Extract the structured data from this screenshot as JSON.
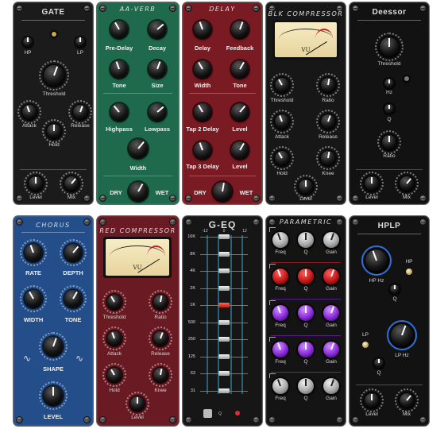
{
  "gate": {
    "title": "GATE",
    "hp": "HP",
    "lp": "LP",
    "threshold": "Threshold",
    "attack": "Attack",
    "release": "Release",
    "hold": "Hold",
    "level": "Level",
    "mix": "Mix"
  },
  "aaverb": {
    "title": "AA-VERB",
    "pre_delay": "Pre-Delay",
    "decay": "Decay",
    "tone": "Tone",
    "size": "Size",
    "highpass": "Highpass",
    "lowpass": "Lowpass",
    "width": "Width",
    "dry": "DRY",
    "wet": "WET"
  },
  "delay": {
    "title": "DELAY",
    "delay": "Delay",
    "feedback": "Feedback",
    "width": "Width",
    "tone": "Tone",
    "tap2_delay": "Tap 2 Delay",
    "level": "Level",
    "tap3_delay": "Tap 3 Delay",
    "level2": "Level",
    "dry": "DRY",
    "wet": "WET"
  },
  "blk_compressor": {
    "title": "BLK COMPRESSOR",
    "vu": "VU",
    "threshold": "Threshold",
    "ratio": "Ratio",
    "attack": "Attack",
    "release": "Release",
    "hold": "Hold",
    "knee": "Knee",
    "level": "Level"
  },
  "deesser": {
    "title": "Deessor",
    "threshold": "Threshold",
    "hz": "Hz",
    "q": "Q",
    "ratio": "Ratio",
    "level": "Level",
    "mix": "Mix"
  },
  "chorus": {
    "title": "CHORUS",
    "rate": "RATE",
    "depth": "DEPTH",
    "width": "WIDTH",
    "tone": "TONE",
    "shape": "SHAPE",
    "level": "LEVEL"
  },
  "red_compressor": {
    "title": "RED COMPRESSOR",
    "vu": "VU",
    "threshold": "Threshold",
    "ratio": "Ratio",
    "attack": "Attack",
    "release": "Release",
    "hold": "Hold",
    "knee": "Knee",
    "level": "Level"
  },
  "geq": {
    "title": "G-EQ",
    "scale": [
      "-12",
      "0",
      "12"
    ],
    "bands": [
      "16K",
      "8K",
      "4K",
      "2K",
      "1K",
      "500",
      "250",
      "125",
      "63",
      "31"
    ],
    "q_label": "Q"
  },
  "parametric": {
    "title": "PARAMETRIC",
    "freq": "Freq",
    "q": "Q",
    "gain": "Gain"
  },
  "hplp": {
    "title": "HPLP",
    "hp_hz": "HP Hz",
    "hp": "HP",
    "q": "Q",
    "lp": "LP",
    "lp_hz": "LP Hz",
    "level": "Level",
    "mix": "Mix"
  },
  "colors": {
    "green": "#1f6a4c",
    "red": "#7a1a22",
    "blue": "#234e8a",
    "dark": "#1c1c1c",
    "black": "#121212"
  }
}
